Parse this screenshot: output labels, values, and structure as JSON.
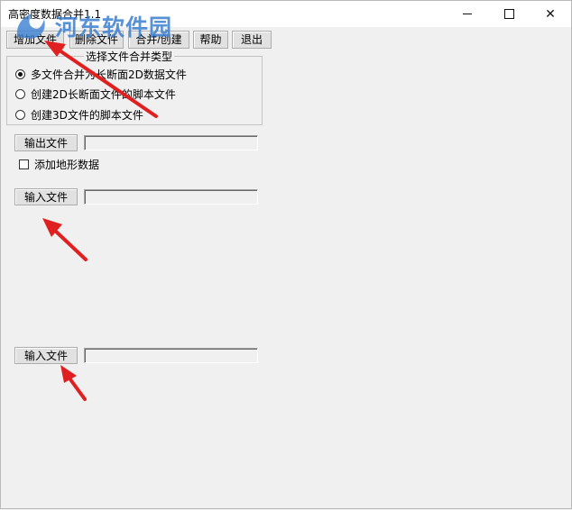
{
  "window": {
    "title": "高密度数据合并1.1",
    "controls": {
      "minimize": "—",
      "maximize": "☐",
      "close": "✕"
    }
  },
  "toolbar": {
    "add_file": "增加文件",
    "delete_file": "删除文件",
    "merge_create": "合并/创建",
    "help": "帮助",
    "exit": "退出"
  },
  "merge_type": {
    "legend": "选择文件合并类型",
    "options": [
      {
        "label": "多文件合并为长断面2D数据文件",
        "checked": true
      },
      {
        "label": "创建2D长断面文件的脚本文件",
        "checked": false
      },
      {
        "label": "创建3D文件的脚本文件",
        "checked": false
      }
    ]
  },
  "output": {
    "button": "输出文件",
    "value": ""
  },
  "terrain": {
    "label": "添加地形数据",
    "checked": false
  },
  "input1": {
    "button": "输入文件",
    "value": ""
  },
  "input2": {
    "button": "输入文件",
    "value": ""
  },
  "watermark": {
    "text": "河东软件园"
  },
  "colors": {
    "background": "#f0f0f0",
    "button_face": "#e1e1e1",
    "annotation_arrow": "#e02020",
    "watermark": "#3a7fd1"
  }
}
